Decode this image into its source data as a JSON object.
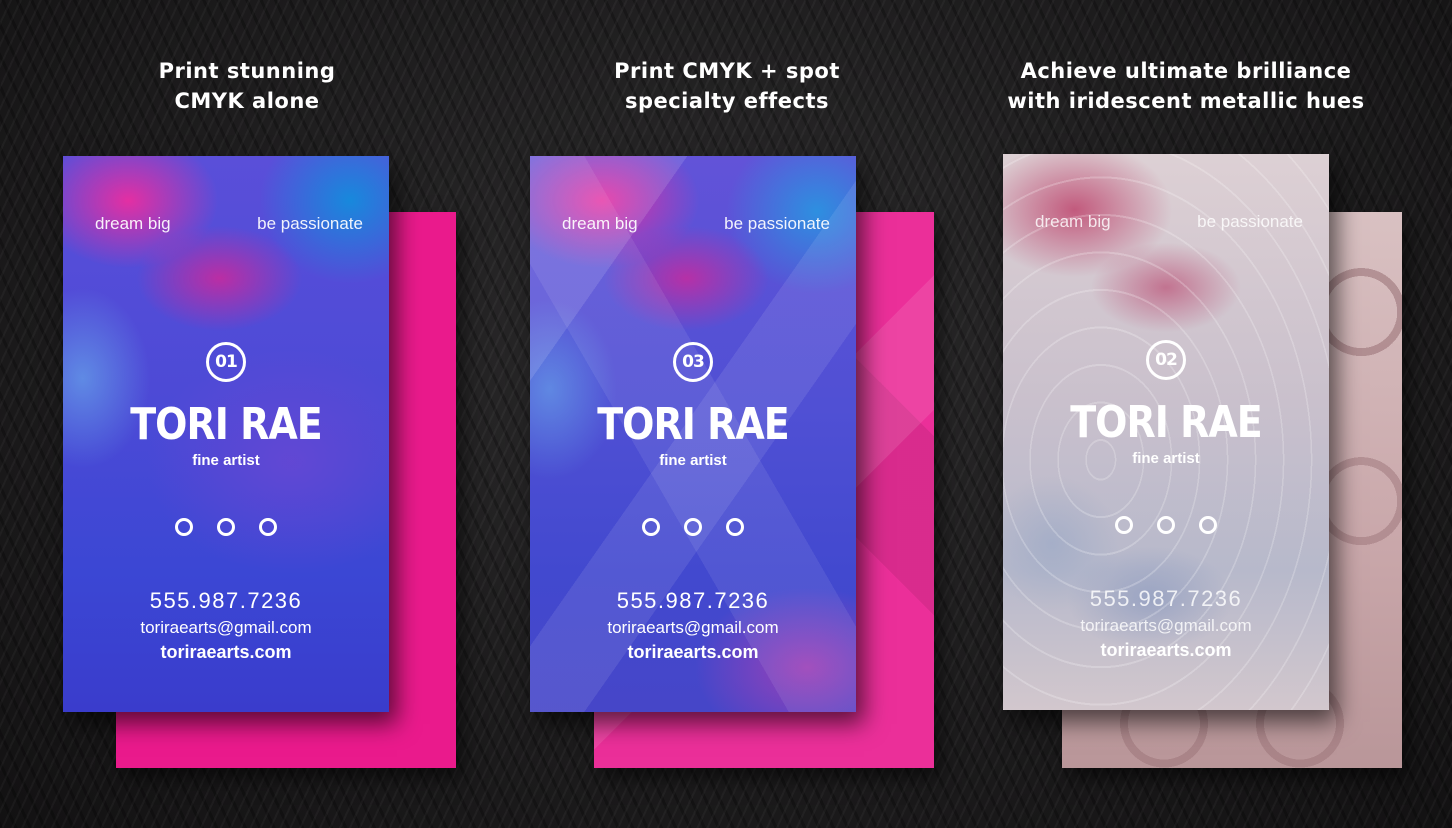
{
  "captions": [
    {
      "line1": "Print stunning",
      "line2": "CMYK alone"
    },
    {
      "line1": "Print CMYK + spot",
      "line2": "specialty effects"
    },
    {
      "line1": "Achieve ultimate brilliance",
      "line2": "with iridescent metallic hues"
    }
  ],
  "cards": [
    {
      "tag_left": "dream big",
      "tag_right": "be passionate",
      "badge": "01",
      "name": "TORI RAE",
      "role": "fine artist",
      "phone": "555.987.7236",
      "email": "toriraearts@gmail.com",
      "website": "toriraearts.com"
    },
    {
      "tag_left": "dream big",
      "tag_right": "be passionate",
      "badge": "03",
      "name": "TORI RAE",
      "role": "fine artist",
      "phone": "555.987.7236",
      "email": "toriraearts@gmail.com",
      "website": "toriraearts.com"
    },
    {
      "tag_left": "dream big",
      "tag_right": "be passionate",
      "badge": "02",
      "name": "TORI RAE",
      "role": "fine artist",
      "phone": "555.987.7236",
      "email": "toriraearts@gmail.com",
      "website": "toriraearts.com"
    }
  ],
  "colors": {
    "background": "#1c1b1c",
    "card1_back": "#ea1a8c",
    "card2_back": "#eb2f99",
    "card3_back": "#d2b6b8",
    "text": "#ffffff"
  }
}
